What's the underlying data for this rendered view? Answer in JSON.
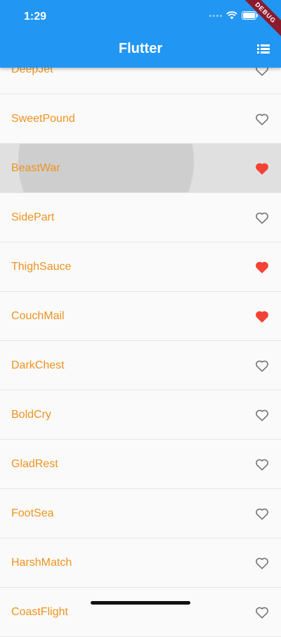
{
  "status": {
    "time": "1:29",
    "debug": "DEBUG"
  },
  "appbar": {
    "title": "Flutter",
    "menu_icon": "list-icon"
  },
  "colors": {
    "appbar": "#2196f3",
    "name": "#f0921e",
    "heart_filled": "#f44336",
    "heart_outline": "#757575"
  },
  "items": [
    {
      "name": "DeepJet",
      "favorite": false
    },
    {
      "name": "SweetPound",
      "favorite": false
    },
    {
      "name": "BeastWar",
      "favorite": true
    },
    {
      "name": "SidePart",
      "favorite": false
    },
    {
      "name": "ThighSauce",
      "favorite": true
    },
    {
      "name": "CouchMail",
      "favorite": true
    },
    {
      "name": "DarkChest",
      "favorite": false
    },
    {
      "name": "BoldCry",
      "favorite": false
    },
    {
      "name": "GladRest",
      "favorite": false
    },
    {
      "name": "FootSea",
      "favorite": false
    },
    {
      "name": "HarshMatch",
      "favorite": false
    },
    {
      "name": "CoastFlight",
      "favorite": false
    }
  ]
}
